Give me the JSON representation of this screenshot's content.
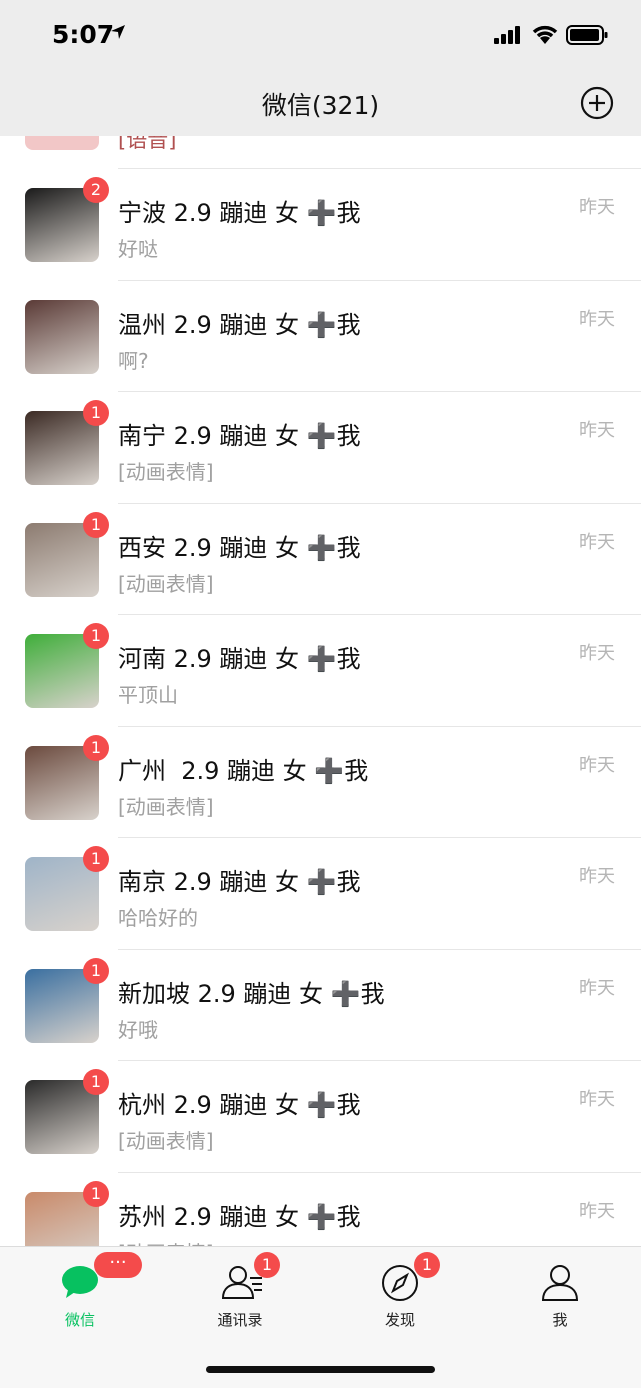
{
  "status": {
    "time": "5:07"
  },
  "nav": {
    "title": "微信(321)"
  },
  "partial_row": {
    "preview": "[语音]"
  },
  "chats": [
    {
      "name": "宁波 2.9 蹦迪 女 ➕我",
      "preview": "好哒",
      "time": "昨天",
      "badge": "2"
    },
    {
      "name": "温州 2.9 蹦迪 女 ➕我",
      "preview": "啊?",
      "time": "昨天",
      "badge": ""
    },
    {
      "name": "南宁 2.9 蹦迪 女 ➕我",
      "preview": "[动画表情]",
      "time": "昨天",
      "badge": "1"
    },
    {
      "name": "西安 2.9 蹦迪 女 ➕我",
      "preview": "[动画表情]",
      "time": "昨天",
      "badge": "1"
    },
    {
      "name": "河南 2.9 蹦迪 女 ➕我",
      "preview": "平顶山",
      "time": "昨天",
      "badge": "1"
    },
    {
      "name": "广州  2.9 蹦迪 女 ➕我",
      "preview": "[动画表情]",
      "time": "昨天",
      "badge": "1"
    },
    {
      "name": "南京 2.9 蹦迪 女 ➕我",
      "preview": "哈哈好的",
      "time": "昨天",
      "badge": "1"
    },
    {
      "name": "新加坡 2.9 蹦迪 女 ➕我",
      "preview": "好哦",
      "time": "昨天",
      "badge": "1"
    },
    {
      "name": "杭州 2.9 蹦迪 女 ➕我",
      "preview": "[动画表情]",
      "time": "昨天",
      "badge": "1"
    },
    {
      "name": "苏州 2.9 蹦迪 女 ➕我",
      "preview": "[动画表情]",
      "time": "昨天",
      "badge": "1"
    }
  ],
  "tabs": [
    {
      "label": "微信",
      "icon": "chat-bubble-icon",
      "badge": "···",
      "active": true
    },
    {
      "label": "通讯录",
      "icon": "contacts-icon",
      "badge": "1",
      "active": false
    },
    {
      "label": "发现",
      "icon": "compass-icon",
      "badge": "1",
      "active": false
    },
    {
      "label": "我",
      "icon": "person-icon",
      "badge": "",
      "active": false
    }
  ],
  "colors": {
    "accent": "#07c160",
    "badge": "#f44b4b",
    "header_bg": "#ededed"
  },
  "avatar_colors": [
    "#1a1a1a",
    "#5a3a36",
    "#3b2a24",
    "#8c7b70",
    "#3fae3a",
    "#6b4a3e",
    "#9fb4c8",
    "#3a6fa0",
    "#2a2a2a",
    "#c98a6a"
  ]
}
